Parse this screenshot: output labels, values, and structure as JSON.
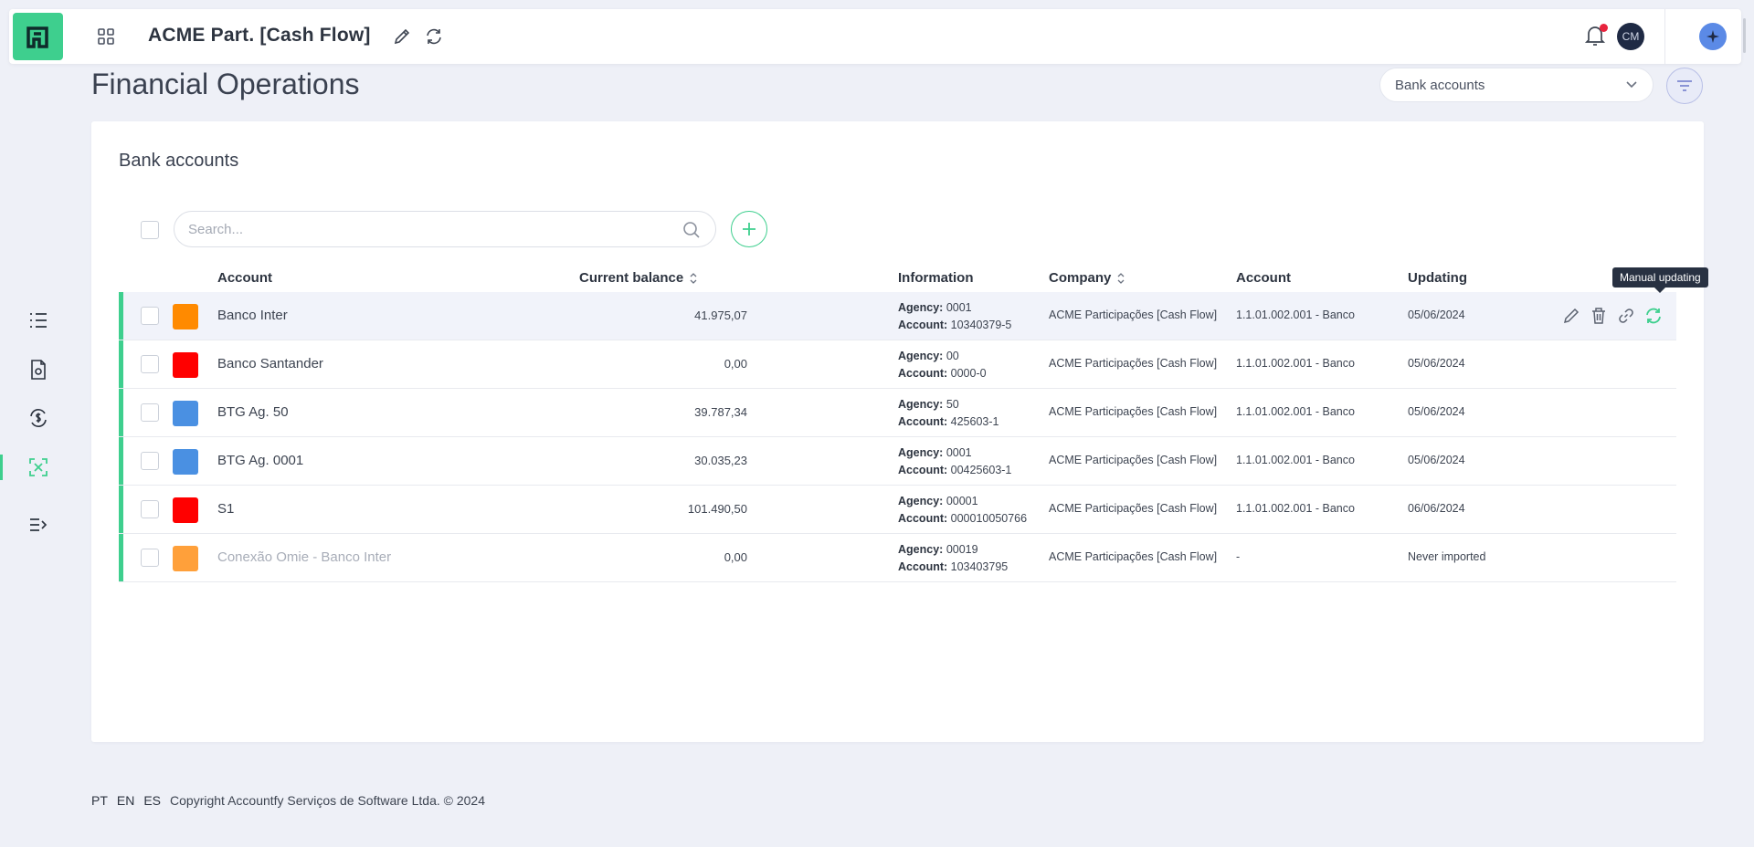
{
  "topbar": {
    "title": "ACME Part. [Cash Flow]",
    "avatar_initials": "CM",
    "brand_color": "#3ecf8e",
    "notification_dot_color": "#e8233d"
  },
  "page": {
    "title": "Financial Operations",
    "view_select": "Bank accounts"
  },
  "card": {
    "title": "Bank accounts",
    "search_placeholder": "Search..."
  },
  "table": {
    "headers": {
      "account": "Account",
      "balance": "Current balance",
      "information": "Information",
      "company": "Company",
      "ledger_account": "Account",
      "updating": "Updating"
    },
    "agency_label": "Agency:",
    "account_label": "Account:",
    "rows": [
      {
        "name": "Banco Inter",
        "color": "#ff8a00",
        "balance": "41.975,07",
        "agency": "0001",
        "account": "10340379-5",
        "company": "ACME Participações [Cash Flow]",
        "ledger": "1.1.01.002.001 - Banco",
        "updating": "05/06/2024"
      },
      {
        "name": "Banco Santander",
        "color": "#ff0000",
        "balance": "0,00",
        "agency": "00",
        "account": "0000-0",
        "company": "ACME Participações [Cash Flow]",
        "ledger": "1.1.01.002.001 - Banco",
        "updating": "05/06/2024"
      },
      {
        "name": "BTG Ag. 50",
        "color": "#4a90e2",
        "balance": "39.787,34",
        "agency": "50",
        "account": "425603-1",
        "company": "ACME Participações [Cash Flow]",
        "ledger": "1.1.01.002.001 - Banco",
        "updating": "05/06/2024"
      },
      {
        "name": "BTG Ag. 0001",
        "color": "#4a90e2",
        "balance": "30.035,23",
        "agency": "0001",
        "account": "00425603-1",
        "company": "ACME Participações [Cash Flow]",
        "ledger": "1.1.01.002.001 - Banco",
        "updating": "05/06/2024"
      },
      {
        "name": "S1",
        "color": "#ff0000",
        "balance": "101.490,50",
        "agency": "00001",
        "account": "000010050766",
        "company": "ACME Participações [Cash Flow]",
        "ledger": "1.1.01.002.001 - Banco",
        "updating": "06/06/2024"
      },
      {
        "name": "Conexão Omie - Banco Inter",
        "color": "#ffa03a",
        "balance": "0,00",
        "agency": "00019",
        "account": "103403795",
        "company": "ACME Participações [Cash Flow]",
        "ledger": "-",
        "updating": "Never imported"
      }
    ]
  },
  "tooltip": "Manual updating",
  "footer": {
    "lang_pt": "PT",
    "lang_en": "EN",
    "lang_es": "ES",
    "copyright": "Copyright Accountfy Serviços de Software Ltda. © 2024"
  }
}
